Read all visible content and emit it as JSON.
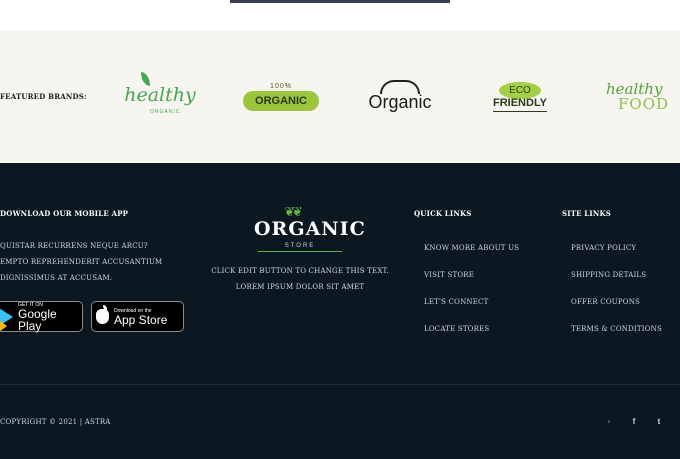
{
  "brands": {
    "label": "FEATURED BRANDS:",
    "items": [
      {
        "name": "healthy",
        "tag": "ORGANIC"
      },
      {
        "name": "ORGANIC",
        "badge": "100%"
      },
      {
        "name": "Organic"
      },
      {
        "name": "FRIENDLY",
        "badge": "ECO"
      },
      {
        "name": "healthy",
        "badge": "FOOD"
      }
    ]
  },
  "footer": {
    "app": {
      "title": "DOWNLOAD OUR MOBILE APP",
      "lines": [
        "QUISTAR RECURRENS NEQUE ARCU?",
        "EMPTO REPREHENDERIT ACCUSANTIUM",
        "DIGNISSIMUS AT ACCUSAM."
      ],
      "google_play": {
        "small": "GET IT ON",
        "big": "Google Play"
      },
      "app_store": {
        "small": "Download on the",
        "big": "App Store"
      }
    },
    "logo": {
      "word": "ORGANIC",
      "sub": "STORE"
    },
    "center_text": [
      "CLICK EDIT BUTTON TO CHANGE THIS TEXT.",
      "LOREM IPSUM DOLOR SIT AMET"
    ],
    "quick_links": {
      "title": "QUICK LINKS",
      "items": [
        "KNOW MORE ABOUT US",
        "VISIT STORE",
        "LET'S CONNECT",
        "LOCATE STORES"
      ]
    },
    "site_links": {
      "title": "SITE LINKS",
      "items": [
        "PRIVACY POLICY",
        "SHIPPING DETAILS",
        "OFFER COUPONS",
        "TERMS & CONDITIONS"
      ]
    },
    "copyright": "COPYRIGHT © 2021 | ASTRA",
    "social": [
      {
        "icon": "instagram-icon",
        "glyph": "◦"
      },
      {
        "icon": "facebook-icon",
        "glyph": "f"
      },
      {
        "icon": "twitter-icon",
        "glyph": "t"
      }
    ]
  },
  "colors": {
    "footer_bg": "#0b1822",
    "brands_bg": "#f6f5f0",
    "accent_green": "#63b33d"
  }
}
